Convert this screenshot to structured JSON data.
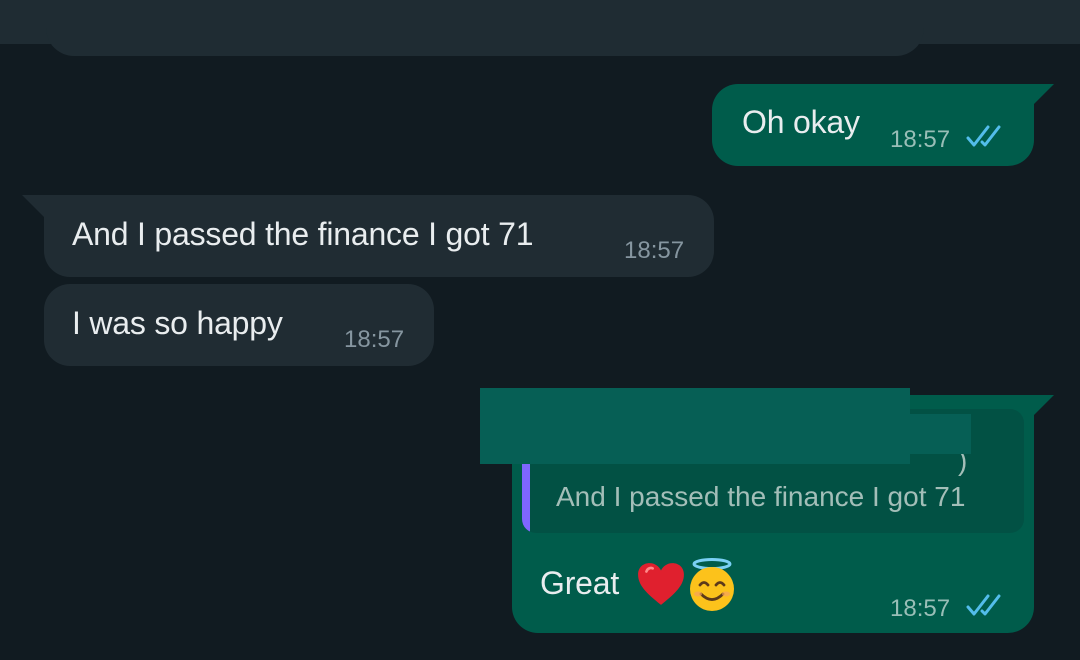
{
  "chat": {
    "messages": [
      {
        "direction": "outgoing",
        "text": "Oh okay",
        "time": "18:57",
        "status": "read"
      },
      {
        "direction": "incoming",
        "text": "And I passed the finance I got 71",
        "time": "18:57"
      },
      {
        "direction": "incoming",
        "text": "I was so happy",
        "time": "18:57"
      },
      {
        "direction": "outgoing",
        "quoted": {
          "text": "And I passed the finance I got 71",
          "glimpse": ")"
        },
        "text": "Great",
        "emojis": [
          "red-heart",
          "smiling-face-with-halo"
        ],
        "time": "18:57",
        "status": "read"
      }
    ]
  },
  "colors": {
    "background": "#111b21",
    "incoming_bubble": "#202c33",
    "outgoing_bubble": "#005c4b",
    "read_ticks": "#53bdeb",
    "quote_bar": "#7f66ff"
  }
}
